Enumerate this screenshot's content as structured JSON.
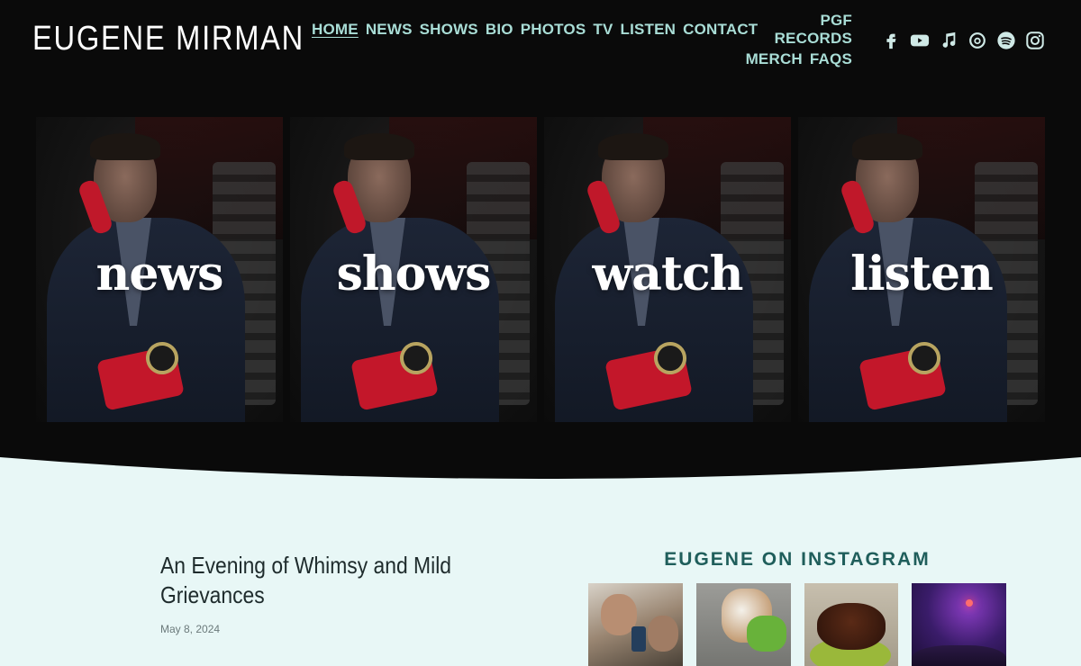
{
  "site": {
    "title": "EUGENE MIRMAN"
  },
  "nav": {
    "row1": [
      {
        "label": "HOME",
        "active": true
      },
      {
        "label": "NEWS"
      },
      {
        "label": "SHOWS"
      },
      {
        "label": "BIO"
      },
      {
        "label": "PHOTOS"
      },
      {
        "label": "TV"
      },
      {
        "label": "LISTEN"
      },
      {
        "label": "CONTACT"
      },
      {
        "label": "PGF RECORDS"
      }
    ],
    "row2": [
      {
        "label": "MERCH"
      },
      {
        "label": "FAQS"
      }
    ]
  },
  "social": [
    {
      "icon": "facebook-icon"
    },
    {
      "icon": "youtube-icon"
    },
    {
      "icon": "music-note-icon"
    },
    {
      "icon": "threads-icon"
    },
    {
      "icon": "spotify-icon"
    },
    {
      "icon": "instagram-icon"
    }
  ],
  "tiles": [
    {
      "label": "news"
    },
    {
      "label": "shows"
    },
    {
      "label": "watch"
    },
    {
      "label": "listen"
    }
  ],
  "post": {
    "title": "An Evening of Whimsy and Mild Grievances",
    "date": "May 8, 2024"
  },
  "instagram": {
    "heading": "EUGENE ON INSTAGRAM",
    "items": [
      {
        "subject": "two-men-photo"
      },
      {
        "subject": "dog-with-toy-photo"
      },
      {
        "subject": "plated-food-photo"
      },
      {
        "subject": "concert-crowd-photo"
      }
    ]
  },
  "colors": {
    "background": "#0a0a0a",
    "nav": "#a9ddd6",
    "light_section": "#e8f7f6",
    "instagram_heading": "#1f5e5b"
  }
}
